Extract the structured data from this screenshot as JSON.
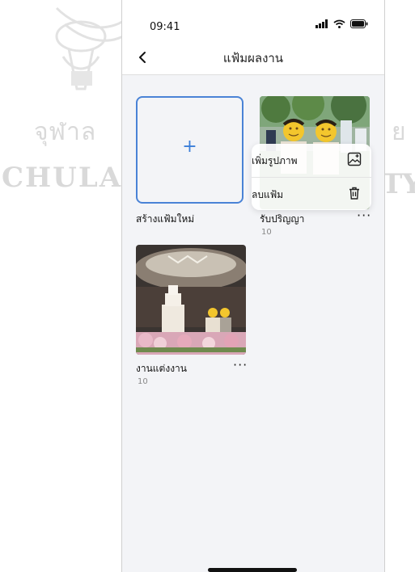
{
  "watermark": {
    "thai_text": "จุฬาล",
    "thai_text_right": "ย",
    "wordmark": "CHULAL",
    "wordmark_right": "TY"
  },
  "status_bar": {
    "time": "09:41",
    "icons": [
      "signal-icon",
      "wifi-icon",
      "battery-icon"
    ]
  },
  "header": {
    "title": "แฟ้มผลงาน"
  },
  "albums": [
    {
      "kind": "new",
      "plus": "+",
      "label": "สร้างแฟ้มใหม่"
    },
    {
      "kind": "album",
      "label": "รับปริญญา",
      "count": "10",
      "more": "···"
    },
    {
      "kind": "album",
      "label": "งานแต่งงาน",
      "count": "10",
      "more": "···"
    }
  ],
  "context_menu": {
    "items": [
      {
        "label": "เพิ่มรูปภาพ",
        "icon": "add-image-icon"
      },
      {
        "label": "ลบแฟ้ม",
        "icon": "trash-icon"
      }
    ]
  },
  "colors": {
    "accent": "#3b7fd9",
    "screen_bg": "#f3f4f7",
    "header_bg": "#ffffff"
  }
}
